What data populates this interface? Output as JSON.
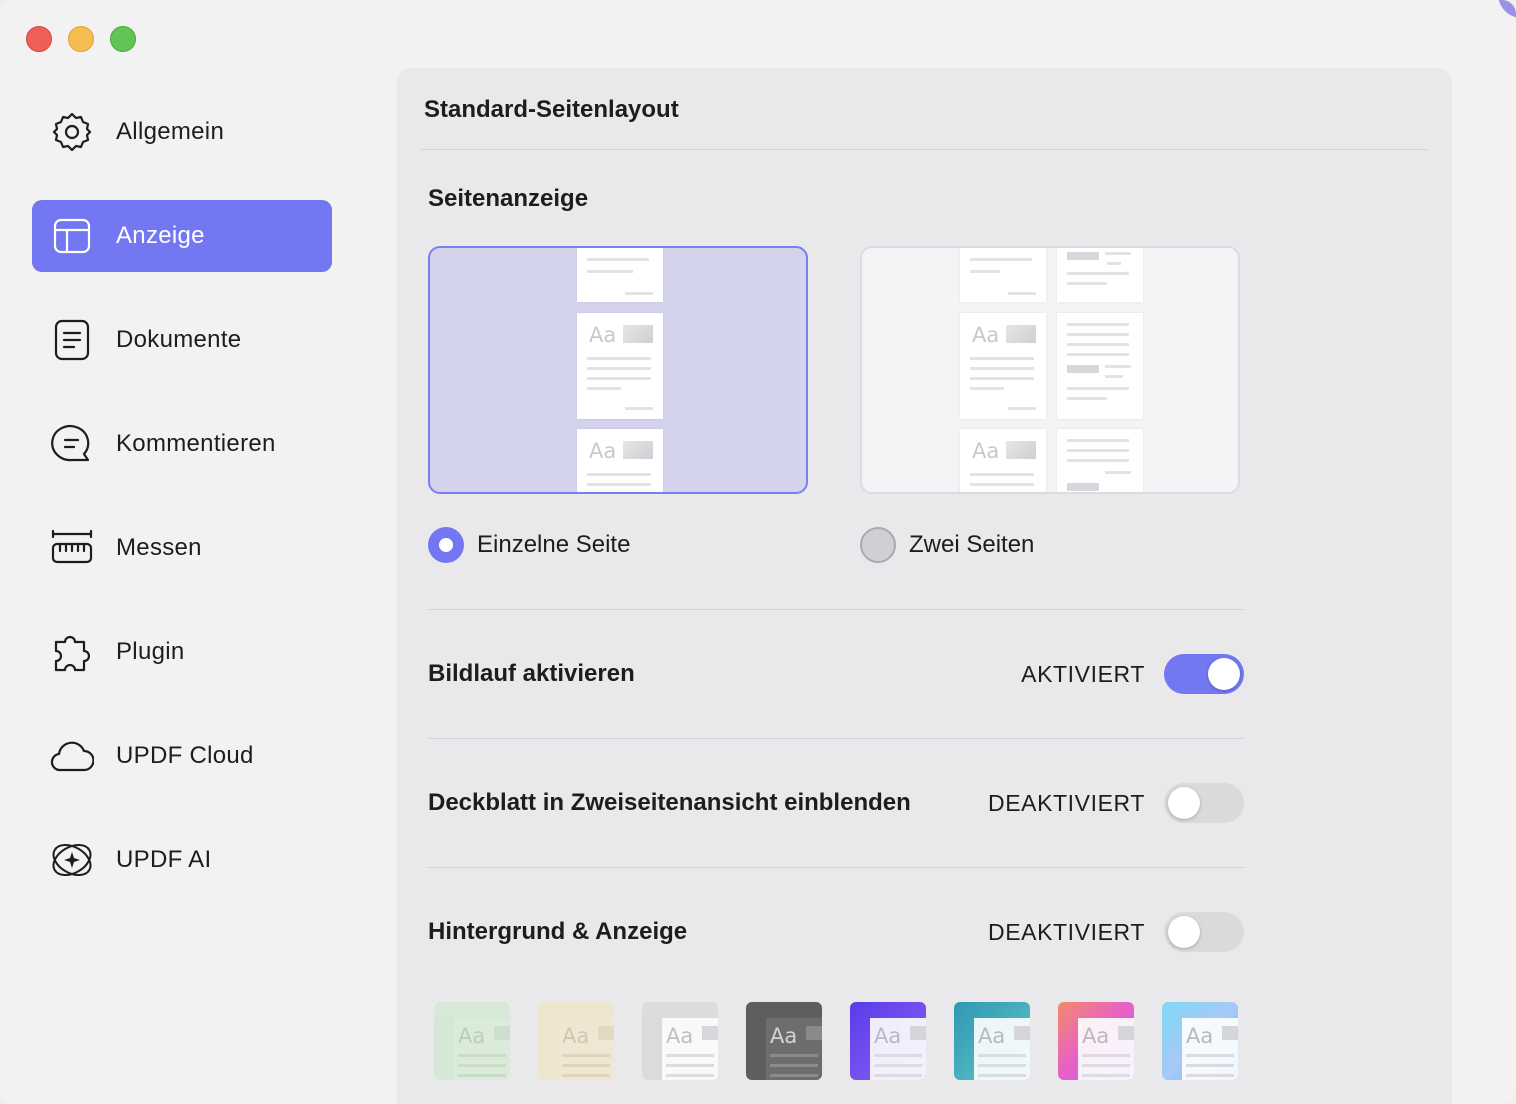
{
  "sidebar": {
    "items": [
      {
        "label": "Allgemein",
        "icon": "gear-icon",
        "active": false
      },
      {
        "label": "Anzeige",
        "icon": "layout-icon",
        "active": true
      },
      {
        "label": "Dokumente",
        "icon": "document-icon",
        "active": false
      },
      {
        "label": "Kommentieren",
        "icon": "comment-icon",
        "active": false
      },
      {
        "label": "Messen",
        "icon": "ruler-icon",
        "active": false
      },
      {
        "label": "Plugin",
        "icon": "puzzle-icon",
        "active": false
      },
      {
        "label": "UPDF Cloud",
        "icon": "cloud-icon",
        "active": false
      },
      {
        "label": "UPDF AI",
        "icon": "ai-sparkle-icon",
        "active": false
      }
    ]
  },
  "panel": {
    "title": "Standard-Seitenlayout",
    "page_view": {
      "title": "Seitenanzeige",
      "options": [
        {
          "label": "Einzelne Seite",
          "selected": true
        },
        {
          "label": "Zwei Seiten",
          "selected": false
        }
      ]
    },
    "settings": [
      {
        "label": "Bildlauf aktivieren",
        "state": "AKTIVIERT",
        "on": true
      },
      {
        "label": "Deckblatt in Zweiseitenansicht einblenden",
        "state": "DEAKTIVIERT",
        "on": false
      },
      {
        "label": "Hintergrund & Anzeige",
        "state": "DEAKTIVIERT",
        "on": false
      }
    ],
    "themes": [
      {
        "name": "green",
        "color": "#cfe8cf",
        "text": "Aa"
      },
      {
        "name": "beige",
        "color": "#efe4c4",
        "text": "Aa"
      },
      {
        "name": "light-gray",
        "color": "#d9d9db",
        "text": "Aa"
      },
      {
        "name": "dark-gray",
        "color": "#5e5e60",
        "text": "Aa"
      },
      {
        "name": "purple",
        "color": "#6f4ef0",
        "text": "Aa"
      },
      {
        "name": "teal",
        "color": "#3fa6b8",
        "text": "Aa"
      },
      {
        "name": "pink-gradient",
        "color": "#e983c7",
        "text": "Aa"
      },
      {
        "name": "sky-gradient",
        "color": "#8ad3f5",
        "text": "Aa"
      }
    ]
  },
  "colors": {
    "accent": "#7378f2",
    "sidebar_bg": "#f2f2f3",
    "panel_bg": "#e9e9eb"
  }
}
